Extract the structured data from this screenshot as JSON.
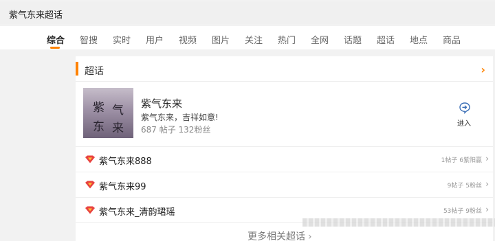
{
  "search": {
    "query": "紫气东来超话"
  },
  "tabs": [
    {
      "label": "综合",
      "active": true
    },
    {
      "label": "智搜"
    },
    {
      "label": "实时"
    },
    {
      "label": "用户"
    },
    {
      "label": "视频"
    },
    {
      "label": "图片"
    },
    {
      "label": "关注"
    },
    {
      "label": "热门"
    },
    {
      "label": "全网"
    },
    {
      "label": "话题"
    },
    {
      "label": "超话"
    },
    {
      "label": "地点"
    },
    {
      "label": "商品"
    }
  ],
  "section": {
    "title": "超话"
  },
  "main_topic": {
    "name": "紫气东来",
    "description": "紫气东来，吉祥如意!",
    "stats": "687 帖子 132粉丝",
    "thumb_text": [
      "紫",
      "气",
      "东",
      "来"
    ],
    "enter_label": "进入"
  },
  "related": [
    {
      "name": "紫气东来888",
      "stats": "1帖子 6紫阳赢"
    },
    {
      "name": "紫气东来99",
      "stats": "9帖子 5粉丝"
    },
    {
      "name": "紫气东来_清韵珺瑶",
      "stats": "53帖子 9粉丝"
    }
  ],
  "more_label": "更多相关超话",
  "colors": {
    "accent": "#ff8200",
    "icon_blue": "#3b6fb6",
    "badge_red": "#e8423f",
    "badge_yellow": "#ffc233"
  }
}
